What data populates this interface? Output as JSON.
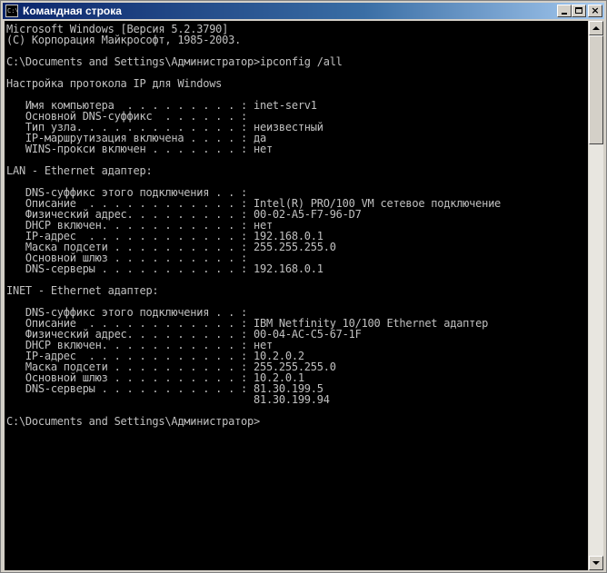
{
  "window": {
    "title": "Командная строка",
    "icon": "cmd-icon",
    "icon_label": "C:\\",
    "buttons": {
      "minimize": "minimize-icon",
      "maximize": "maximize-icon",
      "close": "close-icon",
      "close_glyph": "×"
    }
  },
  "console": {
    "lines": [
      "Microsoft Windows [Версия 5.2.3790]",
      "(С) Корпорация Майкрософт, 1985-2003.",
      "",
      "C:\\Documents and Settings\\Администратор>ipconfig /all",
      "",
      "Настройка протокола IP для Windows",
      "",
      "   Имя компьютера  . . . . . . . . . : inet-serv1",
      "   Основной DNS-суффикс  . . . . . . :",
      "   Тип узла. . . . . . . . . . . . . : неизвестный",
      "   IP-маршрутизация включена . . . . : да",
      "   WINS-прокси включен . . . . . . . : нет",
      "",
      "LAN - Ethernet адаптер:",
      "",
      "   DNS-суффикс этого подключения . . :",
      "   Описание  . . . . . . . . . . . . : Intel(R) PRO/100 VM сетевое подключение",
      "   Физический адрес. . . . . . . . . : 00-02-A5-F7-96-D7",
      "   DHCP включен. . . . . . . . . . . : нет",
      "   IP-адрес  . . . . . . . . . . . . : 192.168.0.1",
      "   Маска подсети . . . . . . . . . . : 255.255.255.0",
      "   Основной шлюз . . . . . . . . . . :",
      "   DNS-серверы . . . . . . . . . . . : 192.168.0.1",
      "",
      "INET - Ethernet адаптер:",
      "",
      "   DNS-суффикс этого подключения . . :",
      "   Описание  . . . . . . . . . . . . : IBM Netfinity 10/100 Ethernet адаптер",
      "   Физический адрес. . . . . . . . . : 00-04-AC-C5-67-1F",
      "   DHCP включен. . . . . . . . . . . : нет",
      "   IP-адрес  . . . . . . . . . . . . : 10.2.0.2",
      "   Маска подсети . . . . . . . . . . : 255.255.255.0",
      "   Основной шлюз . . . . . . . . . . : 10.2.0.1",
      "   DNS-серверы . . . . . . . . . . . : 81.30.199.5",
      "                                       81.30.199.94",
      "",
      "C:\\Documents and Settings\\Администратор>"
    ]
  },
  "colors": {
    "console_bg": "#000000",
    "console_fg": "#c0c0c0",
    "titlebar_start": "#0a246a",
    "titlebar_end": "#a6caf0"
  }
}
